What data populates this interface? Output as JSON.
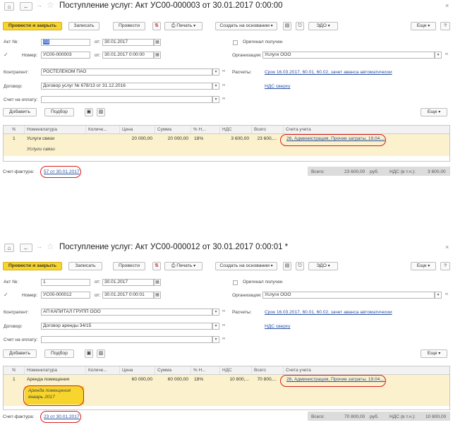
{
  "docs": [
    {
      "title": "Поступление услуг: Акт УС00-000003 от 30.01.2017 0:00:00",
      "toolbar": {
        "post_close": "Провести и закрыть",
        "save": "Записать",
        "post": "Провести",
        "print": "Печать",
        "create_based": "Создать на основании",
        "edo": "ЭДО",
        "more": "Еще",
        "help": "?"
      },
      "form": {
        "act_label": "Акт №:",
        "act_value": "03",
        "from_label": "от:",
        "act_date": "30.01.2017",
        "number_label": "Номер:",
        "number_value": "УС00-000003",
        "number_date": "30.01.2017  0:00:00",
        "original_label": "Оригинал получен",
        "org_label": "Организация:",
        "org_value": "Услуги ООО",
        "contractor_label": "Контрагент:",
        "contractor_value": "РОСТЕЛЕКОМ ПАО",
        "settlements_label": "Расчеты:",
        "settlements_link": "Срок 16.03.2017, 60.01, 60.02, зачет аванса автоматически",
        "contract_label": "Договор:",
        "contract_value": "Договор услуг № 678/13 от 31.12.2016",
        "vat_link": "НДС сверху",
        "invoice_label": "Счет на оплату:",
        "invoice_value": ""
      },
      "table_toolbar": {
        "add": "Добавить",
        "pick": "Подбор",
        "more": "Еще"
      },
      "columns": [
        "N",
        "Номенклатура",
        "Количе...",
        "Цена",
        "Сумма",
        "% Н...",
        "НДС",
        "Всего",
        "Счета учета"
      ],
      "row": {
        "n": "1",
        "item": "Услуги связи",
        "item_content": "Услуги связи",
        "qty": "",
        "price": "20 000,00",
        "sum": "20 000,00",
        "vat_rate": "18%",
        "vat": "3 600,00",
        "total": "23 600,...",
        "accounts": "26, Администрация, Прочие затраты, 19.04...."
      },
      "footer": {
        "invoice_label": "Счет-фактура:",
        "invoice_link": "57 от 30.01.2017",
        "total_label": "Всего:",
        "total_value": "23 600,00",
        "currency": "руб.",
        "vat_label": "НДС (в т.ч.):",
        "vat_value": "3 600,00"
      }
    },
    {
      "title": "Поступление услуг: Акт УС00-000012 от 30.01.2017 0:00:01 *",
      "toolbar": {
        "post_close": "Провести и закрыть",
        "save": "Записать",
        "post": "Провести",
        "print": "Печать",
        "create_based": "Создать на основании",
        "edo": "ЭДО",
        "more": "Еще",
        "help": "?"
      },
      "form": {
        "act_label": "Акт №:",
        "act_value": "1",
        "from_label": "от:",
        "act_date": "30.01.2017",
        "number_label": "Номер:",
        "number_value": "УС00-000012",
        "number_date": "30.01.2017  0:00:01",
        "original_label": "Оригинал получен",
        "org_label": "Организация:",
        "org_value": "Услуги ООО",
        "contractor_label": "Контрагент:",
        "contractor_value": "АП КАПИТАЛ ГРУПП ООО",
        "settlements_label": "Расчеты:",
        "settlements_link": "Срок 16.03.2017, 60.01, 60.02, зачет аванса автоматически",
        "contract_label": "Договор:",
        "contract_value": "Договор аренды 34/15",
        "vat_link": "НДС сверху",
        "invoice_label": "Счет на оплату:",
        "invoice_value": ""
      },
      "table_toolbar": {
        "add": "Добавить",
        "pick": "Подбор",
        "more": "Еще"
      },
      "columns": [
        "N",
        "Номенклатура",
        "Количе...",
        "Цена",
        "Сумма",
        "% Н...",
        "НДС",
        "Всего",
        "Счета учета"
      ],
      "row": {
        "n": "1",
        "item": "Аренда помещения",
        "item_content": "Аренда помещения январь 2017",
        "qty": "",
        "price": "60 000,00",
        "sum": "60 000,00",
        "vat_rate": "18%",
        "vat": "10 800,...",
        "total": "70 800,...",
        "accounts": "26, Администрация, Прочие затраты, 19.04...."
      },
      "footer": {
        "invoice_label": "Счет-фактура:",
        "invoice_link": "23 от 30.01.2017",
        "total_label": "Всего:",
        "total_value": "70 800,00",
        "currency": "руб.",
        "vat_label": "НДС (в т.ч.):",
        "vat_value": "10 800,00"
      }
    }
  ]
}
